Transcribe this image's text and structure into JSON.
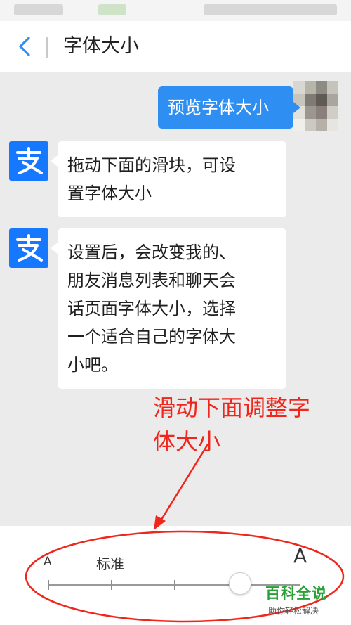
{
  "nav": {
    "title": "字体大小",
    "back_icon": "chevron-left-icon"
  },
  "messages": [
    {
      "side": "right",
      "text": "预览字体大小"
    },
    {
      "side": "left",
      "lines": [
        "拖动下面的滑块，可设",
        "置字体大小"
      ]
    },
    {
      "side": "left",
      "lines": [
        "设置后，会改变我的、",
        "朋友消息列表和聊天会",
        "话页面字体大小，选择",
        "一个适合自己的字体大",
        "小吧。"
      ]
    }
  ],
  "annotation": {
    "lines": [
      "滑动下面调整字",
      "体大小"
    ],
    "color": "#f0261d"
  },
  "font_slider": {
    "small_label": "A",
    "standard_label": "标准",
    "large_label": "A",
    "steps": 4,
    "selected_step": 4
  },
  "watermark": {
    "title": "百科全说",
    "subtitle": "助你轻松解决"
  },
  "colors": {
    "accent": "#2f8ef2",
    "bot_avatar": "#1678ff",
    "watermark": "#27a135"
  }
}
